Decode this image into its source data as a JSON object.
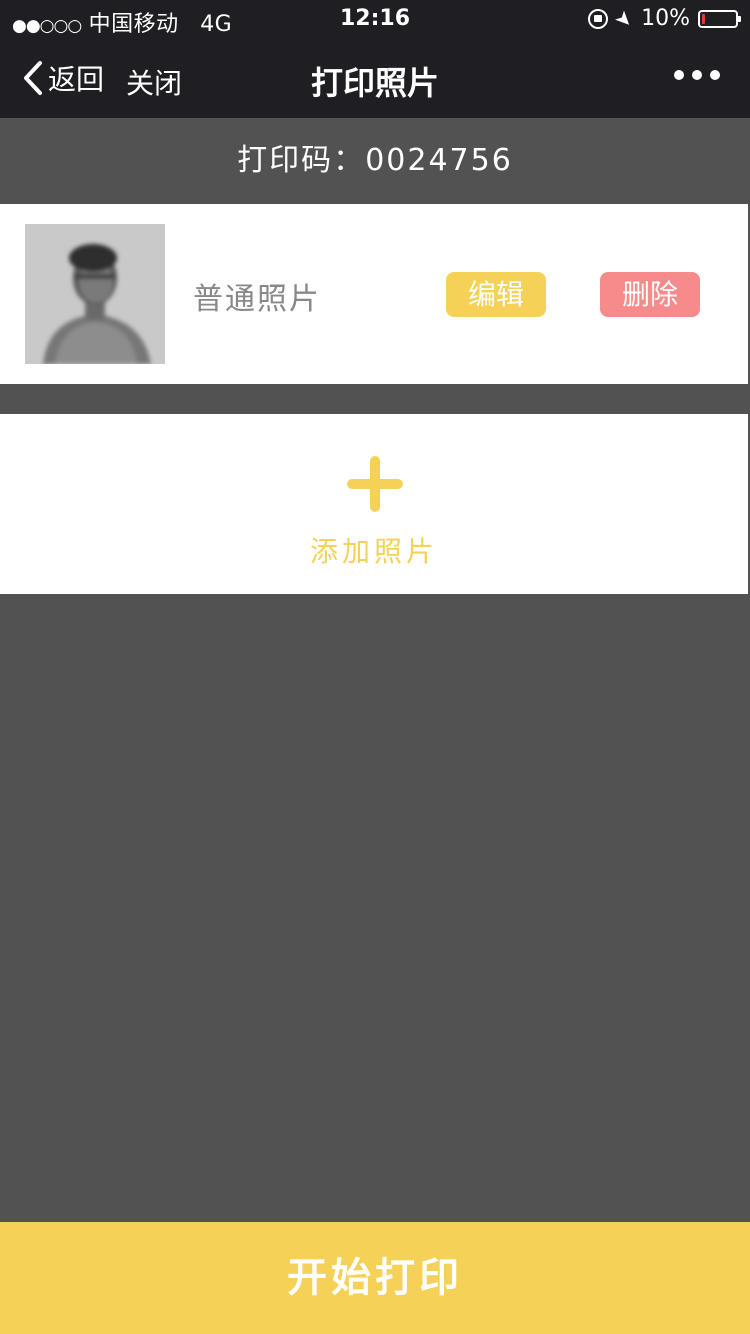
{
  "status_bar": {
    "signal": "●●○○○",
    "carrier": "中国移动",
    "network": "4G",
    "time": "12:16",
    "battery_text": "10%",
    "battery_level": 0.1,
    "battery_color": "#e53935"
  },
  "nav": {
    "back_label": "返回",
    "close_label": "关闭",
    "title": "打印照片",
    "more_icon": "ellipsis-icon"
  },
  "print_code": {
    "label": "打印码：",
    "value": "0024756"
  },
  "photos": [
    {
      "type_label": "普通照片",
      "edit_label": "编辑",
      "delete_label": "删除"
    }
  ],
  "add_photo": {
    "label": "添加照片",
    "icon": "plus-icon"
  },
  "footer": {
    "print_label": "开始打印"
  },
  "colors": {
    "accent_yellow": "#f5d257",
    "delete_red": "#f78b8b",
    "background": "#525252",
    "bar_dark": "#1f1e22"
  }
}
